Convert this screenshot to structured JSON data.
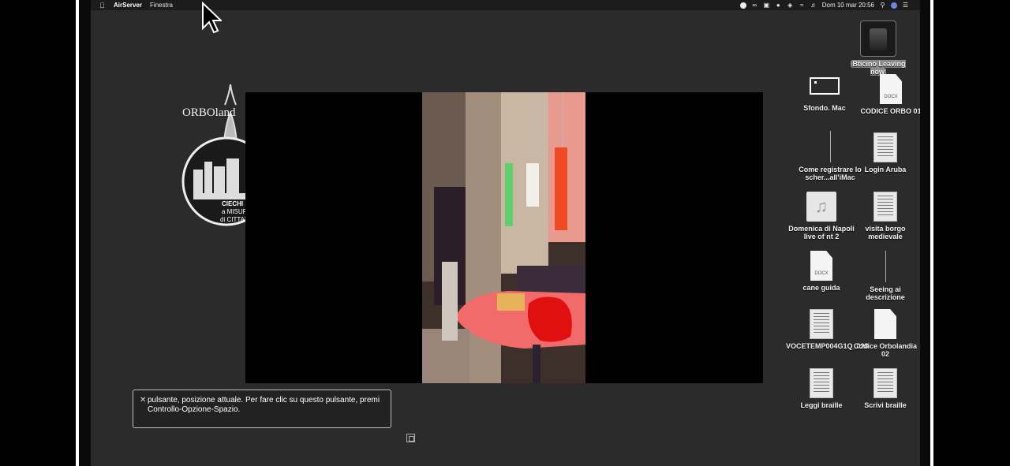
{
  "menubar": {
    "app_name": "AirServer",
    "menu_items": [
      "Finestra"
    ],
    "clock": "Dom 10 mar  20:56"
  },
  "desktop_icons": [
    {
      "label": "Bticino Leaving now",
      "type": "device",
      "selected": true
    },
    {
      "label": "Sfondo. Mac",
      "type": "window"
    },
    {
      "label": "CODICE ORBO 01",
      "type": "docx"
    },
    {
      "label": "Come registrare lo scher...all'iMac",
      "type": "line"
    },
    {
      "label": "Login Aruba",
      "type": "scan"
    },
    {
      "label": "Domenica di Napoli live of nt 2",
      "type": "music"
    },
    {
      "label": "visita borgo medievale",
      "type": "scan"
    },
    {
      "label": "cane guida",
      "type": "docx"
    },
    {
      "label": "Seeing ai descrizione",
      "type": "line"
    },
    {
      "label": "VOCETEMP004G1Q_028",
      "type": "scan"
    },
    {
      "label": "Codice Orbolandia 02",
      "type": "doc"
    },
    {
      "label": "Leggi braille",
      "type": "scan"
    },
    {
      "label": "Scrivi braille",
      "type": "scan"
    }
  ],
  "docx_tag": "DOCX",
  "voiceover": {
    "close_glyph": "✕",
    "caption": "pulsante, posizione attuale. Per fare clic su questo pulsante, premi Controllo-Opzione-Spazio."
  },
  "logo": {
    "wordmark": "ORBOland",
    "lines": [
      "CIECHI",
      "a MISURA",
      "di CITTA'"
    ]
  },
  "colors": {
    "desktop_bg": "#2b2b2b",
    "menubar_bg": "#1c1c1c",
    "frame_border": "#ffffff"
  }
}
